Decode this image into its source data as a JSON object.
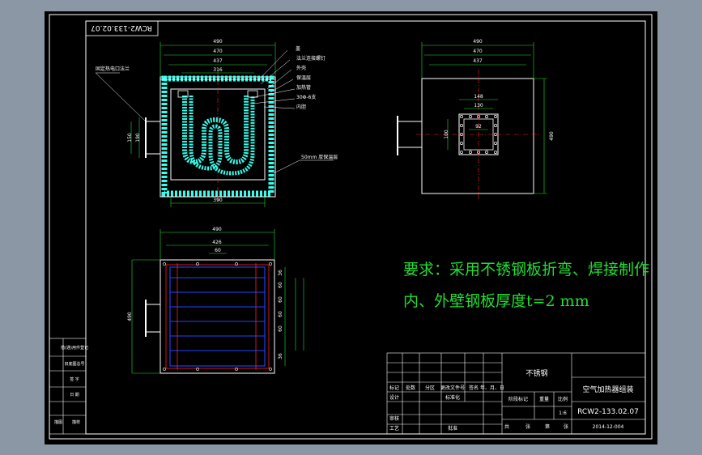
{
  "drawing": {
    "background_color": "#000000",
    "frame_color": "#ffffff",
    "line_color_main": "#ffffff",
    "dim_color": "#22dd33",
    "center_line_color": "#ff2020",
    "insulation_color": "#33ffee",
    "tube_color": "#2244ff"
  },
  "corner_code": "RCW2-133.02.07",
  "front_view": {
    "dims": {
      "top_overall": "490",
      "top_mid": "470",
      "top_inner": "437",
      "top_small": "316",
      "left_outer": "150",
      "left_inner": "190",
      "bottom": "390"
    },
    "callouts": {
      "left": "固定热电口法兰",
      "right": [
        "盖",
        "法兰连接螺钉",
        "外壳",
        "保温层",
        "加热管",
        "30Φ-6支",
        "内胆"
      ],
      "bottom": "50mm 厚保温层"
    }
  },
  "side_view": {
    "dims": {
      "top_overall": "490",
      "top_mid": "470",
      "top_inner": "437",
      "flange_outer": "148",
      "flange_inner": "130",
      "flange_center": "92",
      "left": "100",
      "right": "490"
    }
  },
  "bottom_view": {
    "dims": {
      "top_overall": "490",
      "top_inner": "426",
      "top_small": "60",
      "left": "490",
      "right_rows": [
        "36",
        "60",
        "60",
        "60",
        "60",
        "36"
      ]
    }
  },
  "requirements": {
    "line1": "要求：采用不锈钢板折弯、焊接制作",
    "line2": "内、外壁钢板厚度t=2 mm"
  },
  "title_block": {
    "material": "不锈钢",
    "title": "空气加热器组装",
    "drawing_no": "RCW2-133.02.07",
    "date": "2014-12-004",
    "scale": "1:6",
    "headers": [
      "标记",
      "处数",
      "分区",
      "更改文件号",
      "签名",
      "年、月、日"
    ],
    "row_design": [
      "设计",
      "标准化"
    ],
    "row_check": [
      "审核"
    ],
    "row_process": [
      "工艺",
      "批准"
    ],
    "stage_header": [
      "阶段标记",
      "重量",
      "比例"
    ],
    "sheet": [
      "共",
      "张",
      "第",
      "张"
    ]
  },
  "left_strip": [
    "借(通)用件登记",
    "旧底图总号",
    "底图总号",
    "签  字",
    "日  期",
    "描图",
    "描校"
  ]
}
